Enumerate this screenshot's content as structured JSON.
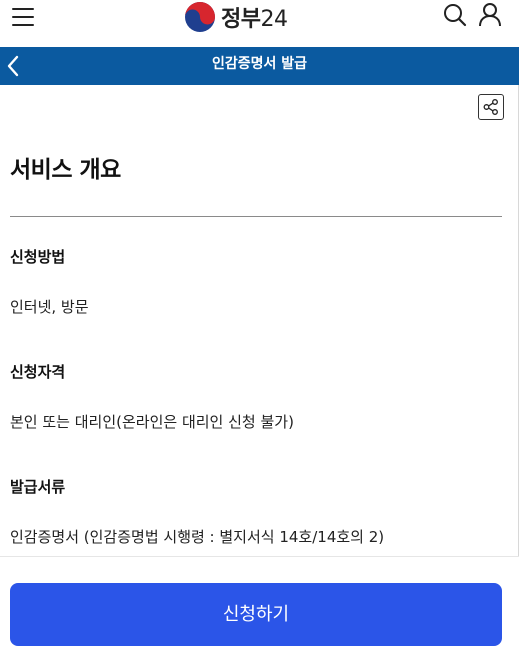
{
  "header": {
    "logo_text": "정부",
    "logo_number": "24",
    "menu_icon": "hamburger-menu-icon",
    "search_icon": "search-icon",
    "user_icon": "user-icon"
  },
  "titlebar": {
    "title": "인감증명서 발급",
    "back_icon": "chevron-left-icon",
    "background": "#0b5aa0"
  },
  "share": {
    "icon": "share-icon"
  },
  "overview": {
    "heading": "서비스 개요",
    "items": [
      {
        "label": "신청방법",
        "value": "인터넷, 방문"
      },
      {
        "label": "신청자격",
        "value": "본인 또는 대리인(온라인은 대리인 신청 불가)"
      },
      {
        "label": "발급서류",
        "value": "인감증명서 (인감증명법 시행령 : 별지서식 14호/14호의 2)"
      }
    ]
  },
  "footer": {
    "apply_label": "신청하기",
    "apply_color": "#2b55e8"
  }
}
